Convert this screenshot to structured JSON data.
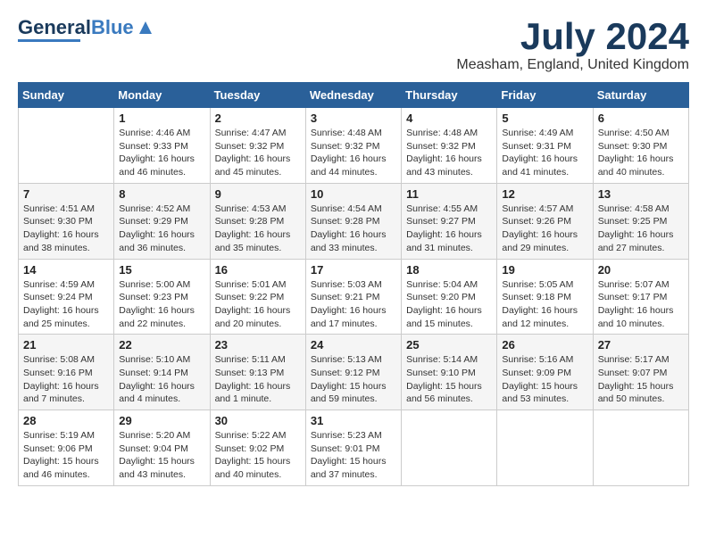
{
  "header": {
    "logo_general": "General",
    "logo_blue": "Blue",
    "month_year": "July 2024",
    "location": "Measham, England, United Kingdom"
  },
  "weekdays": [
    "Sunday",
    "Monday",
    "Tuesday",
    "Wednesday",
    "Thursday",
    "Friday",
    "Saturday"
  ],
  "weeks": [
    [
      {
        "day": "",
        "info": ""
      },
      {
        "day": "1",
        "info": "Sunrise: 4:46 AM\nSunset: 9:33 PM\nDaylight: 16 hours\nand 46 minutes."
      },
      {
        "day": "2",
        "info": "Sunrise: 4:47 AM\nSunset: 9:32 PM\nDaylight: 16 hours\nand 45 minutes."
      },
      {
        "day": "3",
        "info": "Sunrise: 4:48 AM\nSunset: 9:32 PM\nDaylight: 16 hours\nand 44 minutes."
      },
      {
        "day": "4",
        "info": "Sunrise: 4:48 AM\nSunset: 9:32 PM\nDaylight: 16 hours\nand 43 minutes."
      },
      {
        "day": "5",
        "info": "Sunrise: 4:49 AM\nSunset: 9:31 PM\nDaylight: 16 hours\nand 41 minutes."
      },
      {
        "day": "6",
        "info": "Sunrise: 4:50 AM\nSunset: 9:30 PM\nDaylight: 16 hours\nand 40 minutes."
      }
    ],
    [
      {
        "day": "7",
        "info": "Sunrise: 4:51 AM\nSunset: 9:30 PM\nDaylight: 16 hours\nand 38 minutes."
      },
      {
        "day": "8",
        "info": "Sunrise: 4:52 AM\nSunset: 9:29 PM\nDaylight: 16 hours\nand 36 minutes."
      },
      {
        "day": "9",
        "info": "Sunrise: 4:53 AM\nSunset: 9:28 PM\nDaylight: 16 hours\nand 35 minutes."
      },
      {
        "day": "10",
        "info": "Sunrise: 4:54 AM\nSunset: 9:28 PM\nDaylight: 16 hours\nand 33 minutes."
      },
      {
        "day": "11",
        "info": "Sunrise: 4:55 AM\nSunset: 9:27 PM\nDaylight: 16 hours\nand 31 minutes."
      },
      {
        "day": "12",
        "info": "Sunrise: 4:57 AM\nSunset: 9:26 PM\nDaylight: 16 hours\nand 29 minutes."
      },
      {
        "day": "13",
        "info": "Sunrise: 4:58 AM\nSunset: 9:25 PM\nDaylight: 16 hours\nand 27 minutes."
      }
    ],
    [
      {
        "day": "14",
        "info": "Sunrise: 4:59 AM\nSunset: 9:24 PM\nDaylight: 16 hours\nand 25 minutes."
      },
      {
        "day": "15",
        "info": "Sunrise: 5:00 AM\nSunset: 9:23 PM\nDaylight: 16 hours\nand 22 minutes."
      },
      {
        "day": "16",
        "info": "Sunrise: 5:01 AM\nSunset: 9:22 PM\nDaylight: 16 hours\nand 20 minutes."
      },
      {
        "day": "17",
        "info": "Sunrise: 5:03 AM\nSunset: 9:21 PM\nDaylight: 16 hours\nand 17 minutes."
      },
      {
        "day": "18",
        "info": "Sunrise: 5:04 AM\nSunset: 9:20 PM\nDaylight: 16 hours\nand 15 minutes."
      },
      {
        "day": "19",
        "info": "Sunrise: 5:05 AM\nSunset: 9:18 PM\nDaylight: 16 hours\nand 12 minutes."
      },
      {
        "day": "20",
        "info": "Sunrise: 5:07 AM\nSunset: 9:17 PM\nDaylight: 16 hours\nand 10 minutes."
      }
    ],
    [
      {
        "day": "21",
        "info": "Sunrise: 5:08 AM\nSunset: 9:16 PM\nDaylight: 16 hours\nand 7 minutes."
      },
      {
        "day": "22",
        "info": "Sunrise: 5:10 AM\nSunset: 9:14 PM\nDaylight: 16 hours\nand 4 minutes."
      },
      {
        "day": "23",
        "info": "Sunrise: 5:11 AM\nSunset: 9:13 PM\nDaylight: 16 hours\nand 1 minute."
      },
      {
        "day": "24",
        "info": "Sunrise: 5:13 AM\nSunset: 9:12 PM\nDaylight: 15 hours\nand 59 minutes."
      },
      {
        "day": "25",
        "info": "Sunrise: 5:14 AM\nSunset: 9:10 PM\nDaylight: 15 hours\nand 56 minutes."
      },
      {
        "day": "26",
        "info": "Sunrise: 5:16 AM\nSunset: 9:09 PM\nDaylight: 15 hours\nand 53 minutes."
      },
      {
        "day": "27",
        "info": "Sunrise: 5:17 AM\nSunset: 9:07 PM\nDaylight: 15 hours\nand 50 minutes."
      }
    ],
    [
      {
        "day": "28",
        "info": "Sunrise: 5:19 AM\nSunset: 9:06 PM\nDaylight: 15 hours\nand 46 minutes."
      },
      {
        "day": "29",
        "info": "Sunrise: 5:20 AM\nSunset: 9:04 PM\nDaylight: 15 hours\nand 43 minutes."
      },
      {
        "day": "30",
        "info": "Sunrise: 5:22 AM\nSunset: 9:02 PM\nDaylight: 15 hours\nand 40 minutes."
      },
      {
        "day": "31",
        "info": "Sunrise: 5:23 AM\nSunset: 9:01 PM\nDaylight: 15 hours\nand 37 minutes."
      },
      {
        "day": "",
        "info": ""
      },
      {
        "day": "",
        "info": ""
      },
      {
        "day": "",
        "info": ""
      }
    ]
  ]
}
